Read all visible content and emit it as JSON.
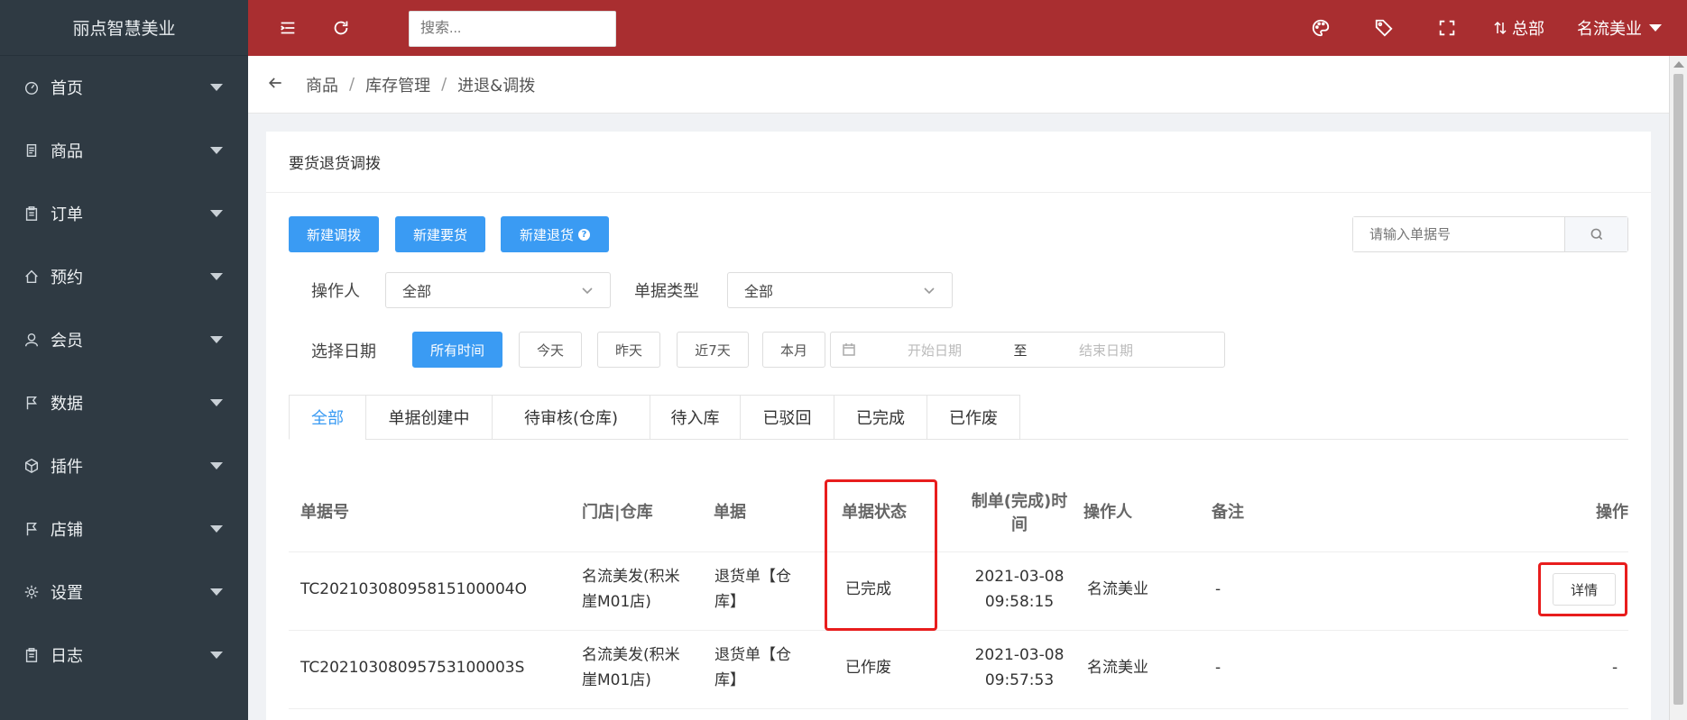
{
  "sidebar": {
    "brand": "丽点智慧美业",
    "items": [
      {
        "label": "首页",
        "icon": "dashboard-icon"
      },
      {
        "label": "商品",
        "icon": "document-icon"
      },
      {
        "label": "订单",
        "icon": "clipboard-icon"
      },
      {
        "label": "预约",
        "icon": "home-icon"
      },
      {
        "label": "会员",
        "icon": "user-icon"
      },
      {
        "label": "数据",
        "icon": "flag-icon"
      },
      {
        "label": "插件",
        "icon": "package-icon"
      },
      {
        "label": "店铺",
        "icon": "flag-icon"
      },
      {
        "label": "设置",
        "icon": "gear-icon"
      },
      {
        "label": "日志",
        "icon": "clipboard-icon"
      }
    ]
  },
  "topbar": {
    "search_placeholder": "搜索...",
    "hq_label": "总部",
    "user_label": "名流美业",
    "bg_color": "#a92e30"
  },
  "breadcrumb": [
    "商品",
    "库存管理",
    "进退&调拨"
  ],
  "card": {
    "title": "要货退货调拨",
    "buttons": {
      "new_transfer": "新建调拨",
      "new_request": "新建要货",
      "new_return": "新建退货"
    },
    "doc_search_placeholder": "请输入单据号"
  },
  "filters": {
    "operator_label": "操作人",
    "operator_value": "全部",
    "doc_type_label": "单据类型",
    "doc_type_value": "全部",
    "date_label": "选择日期",
    "date_options": [
      "所有时间",
      "今天",
      "昨天",
      "近7天",
      "本月"
    ],
    "date_start_placeholder": "开始日期",
    "date_to": "至",
    "date_end_placeholder": "结束日期"
  },
  "tabs": [
    "全部",
    "单据创建中",
    "待审核(仓库)",
    "待入库",
    "已驳回",
    "已完成",
    "已作废"
  ],
  "table": {
    "headers": {
      "doc_no": "单据号",
      "store": "门店|仓库",
      "doc": "单据",
      "status": "单据状态",
      "time_line1": "制单(完成)时",
      "time_line2": "间",
      "operator": "操作人",
      "remark": "备注",
      "action": "操作"
    },
    "rows": [
      {
        "doc_no": "TC20210308095815100004O",
        "store_line1": "名流美发(积米",
        "store_line2": "崖M01店)",
        "doc_line1": "退货单【仓",
        "doc_line2": "库】",
        "status": "已完成",
        "date": "2021-03-08",
        "time": "09:58:15",
        "operator": "名流美业",
        "remark": "-",
        "action": "详情"
      },
      {
        "doc_no": "TC20210308095753100003S",
        "store_line1": "名流美发(积米",
        "store_line2": "崖M01店)",
        "doc_line1": "退货单【仓",
        "doc_line2": "库】",
        "status": "已作废",
        "date": "2021-03-08",
        "time": "09:57:53",
        "operator": "名流美业",
        "remark": "-",
        "action": "-"
      }
    ]
  }
}
